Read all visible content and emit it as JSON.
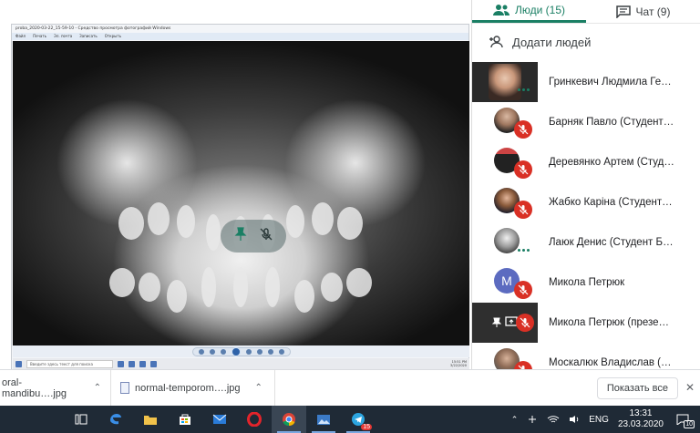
{
  "shared_screen": {
    "window_title": "proba_2020-03-22_15-59-10 - Средство просмотра фотографий Windows",
    "menu": [
      "Файл",
      "Печать",
      "Эл. почта",
      "Записать",
      "Открыть"
    ],
    "search_placeholder": "Введите здесь текст для поиска",
    "clock_time": "15:51 PM",
    "clock_date": "3/22/2020"
  },
  "panel": {
    "tab_people": "Люди (15)",
    "tab_chat": "Чат (9)",
    "add_people": "Додати людей",
    "participants": [
      {
        "name": "Гринкевич Людмила Георгіїв…",
        "state": "speaking",
        "avatar": "photo-female"
      },
      {
        "name": "Барняк Павло (Студент БДМ…",
        "state": "muted",
        "avatar": "photo-male"
      },
      {
        "name": "Деревянко Артем (Студент Б…",
        "state": "muted",
        "avatar": "photo-dark"
      },
      {
        "name": "Жабко Каріна (Студент БДМУ)",
        "state": "muted",
        "avatar": "photo-female2"
      },
      {
        "name": "Лаюк Денис (Студент БДМУ)",
        "state": "speaking",
        "avatar": "photo-bw"
      },
      {
        "name": "Микола Петрюк",
        "state": "muted",
        "avatar": "letter",
        "letter": "M",
        "color": "#5c6bc0"
      },
      {
        "name": "Микола Петрюк (презентація)",
        "state": "muted",
        "avatar": "presentation"
      },
      {
        "name": "Москалюк Владислав (Студе…",
        "state": "muted",
        "avatar": "photo-male2"
      }
    ]
  },
  "downloads": {
    "items": [
      {
        "name": "oral-mandibu….jpg"
      },
      {
        "name": "normal-temporom….jpg"
      }
    ],
    "show_all": "Показать все"
  },
  "taskbar": {
    "lang": "ENG",
    "time": "13:31",
    "date": "23.03.2020",
    "telegram_badge": "15",
    "notifications": "10"
  },
  "colors": {
    "accent": "#1a7f64",
    "muted_red": "#d93025",
    "taskbar_bg": "#1f2a36"
  }
}
